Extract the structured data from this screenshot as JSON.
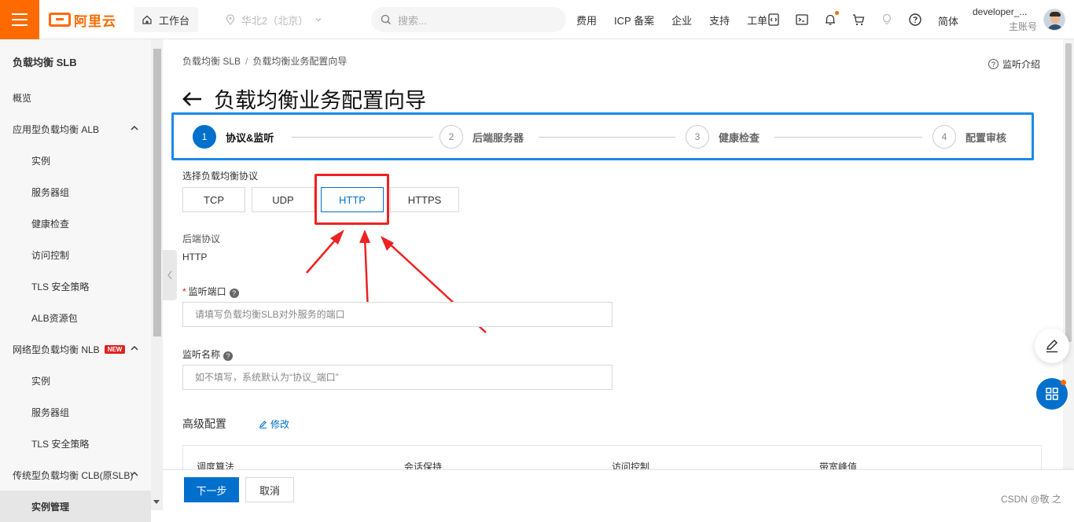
{
  "topbar": {
    "logo_text": "阿里云",
    "workbench": "工作台",
    "region": "华北2（北京）",
    "search_placeholder": "搜索...",
    "links": [
      "费用",
      "ICP 备案",
      "企业",
      "支持",
      "工单"
    ],
    "icons": [
      "code-icon",
      "terminal-icon",
      "bell-icon",
      "cart-icon",
      "lightbulb-icon",
      "help-icon"
    ],
    "language": "简体",
    "user_name": "developer_...",
    "user_role": "主账号",
    "accent_color": "#ff6a00"
  },
  "sidebar": {
    "title": "负载均衡 SLB",
    "items": [
      {
        "label": "概览",
        "level": 0
      },
      {
        "label": "应用型负载均衡 ALB",
        "level": 0,
        "expanded": true
      },
      {
        "label": "实例",
        "level": 1
      },
      {
        "label": "服务器组",
        "level": 1
      },
      {
        "label": "健康检查",
        "level": 1
      },
      {
        "label": "访问控制",
        "level": 1
      },
      {
        "label": "TLS 安全策略",
        "level": 1
      },
      {
        "label": "ALB资源包",
        "level": 1
      },
      {
        "label": "网络型负载均衡 NLB",
        "level": 0,
        "expanded": true,
        "badge": "NEW"
      },
      {
        "label": "实例",
        "level": 1
      },
      {
        "label": "服务器组",
        "level": 1
      },
      {
        "label": "TLS 安全策略",
        "level": 1
      },
      {
        "label": "传统型负载均衡 CLB(原SLB)",
        "level": 0,
        "expanded": true
      },
      {
        "label": "实例管理",
        "level": 1,
        "active": true
      }
    ]
  },
  "breadcrumb": [
    "负载均衡 SLB",
    "负载均衡业务配置向导"
  ],
  "help_link": "监听介绍",
  "page_title": "负载均衡业务配置向导",
  "steps": [
    {
      "num": "1",
      "label": "协议&监听",
      "active": true
    },
    {
      "num": "2",
      "label": "后端服务器"
    },
    {
      "num": "3",
      "label": "健康检查"
    },
    {
      "num": "4",
      "label": "配置审核"
    }
  ],
  "protocol": {
    "label": "选择负载均衡协议",
    "options": [
      "TCP",
      "UDP",
      "HTTP",
      "HTTPS"
    ],
    "selected": "HTTP"
  },
  "backend_protocol": {
    "label": "后端协议",
    "value": "HTTP"
  },
  "listen_port": {
    "required_mark": "*",
    "label": "监听端口",
    "placeholder": "请填写负载均衡SLB对外服务的端口"
  },
  "listen_name": {
    "label": "监听名称",
    "placeholder": "如不填写，系统默认为“协议_端口”"
  },
  "advanced": {
    "title": "高级配置",
    "edit_label": "修改",
    "columns": [
      "调度算法",
      "会话保持",
      "访问控制",
      "带宽峰值"
    ]
  },
  "footer": {
    "next_label": "下一步",
    "cancel_label": "取消"
  },
  "watermark": "CSDN @敬 之",
  "annotation_color": "#ee2222"
}
